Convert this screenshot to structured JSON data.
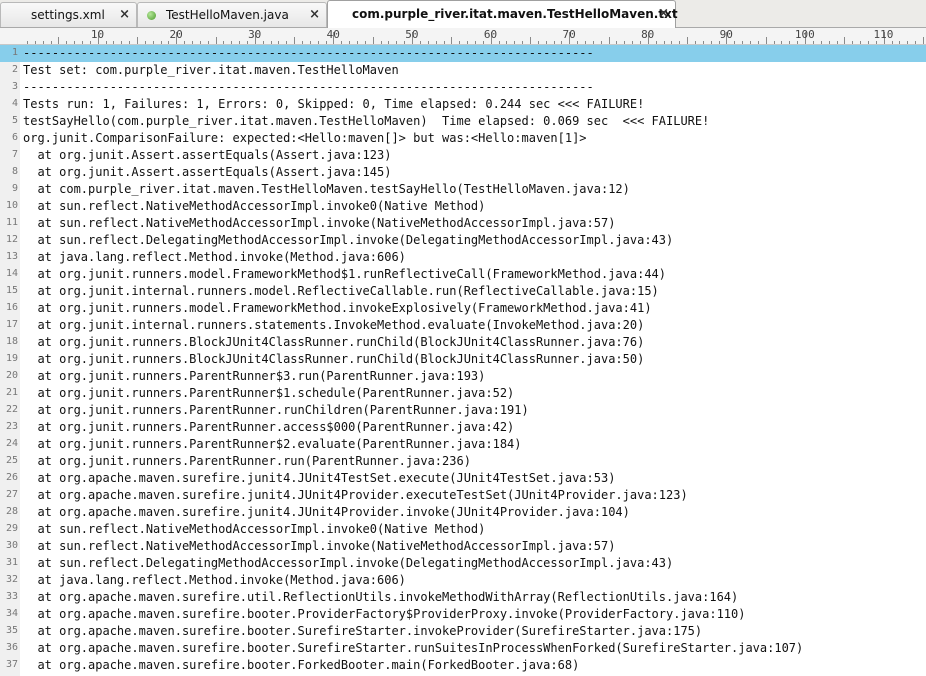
{
  "tabs": [
    {
      "label": "settings.xml",
      "close": "×",
      "icon": "none",
      "active": false
    },
    {
      "label": "TestHelloMaven.java",
      "close": "×",
      "icon": "green-dot-icon",
      "active": false
    },
    {
      "label": "com.purple_river.itat.maven.TestHelloMaven.txt",
      "close": "×",
      "icon": "none",
      "active": true
    }
  ],
  "ruler": {
    "labels": [
      "10",
      "20",
      "30",
      "40",
      "50",
      "60",
      "70",
      "80",
      "90",
      "100",
      "110"
    ]
  },
  "colors": {
    "current_line": "#87ceeb",
    "gutter": "#f0f0f0",
    "tabbar": "#ecebe8"
  },
  "editor": {
    "lines": [
      {
        "n": "1",
        "text": "-------------------------------------------------------------------------------"
      },
      {
        "n": "2",
        "text": "Test set: com.purple_river.itat.maven.TestHelloMaven"
      },
      {
        "n": "3",
        "text": "-------------------------------------------------------------------------------"
      },
      {
        "n": "4",
        "text": "Tests run: 1, Failures: 1, Errors: 0, Skipped: 0, Time elapsed: 0.244 sec <<< FAILURE!"
      },
      {
        "n": "5",
        "text": "testSayHello(com.purple_river.itat.maven.TestHelloMaven)  Time elapsed: 0.069 sec  <<< FAILURE!"
      },
      {
        "n": "6",
        "text": "org.junit.ComparisonFailure: expected:<Hello:maven[]> but was:<Hello:maven[1]>"
      },
      {
        "n": "7",
        "text": "  at org.junit.Assert.assertEquals(Assert.java:123)"
      },
      {
        "n": "8",
        "text": "  at org.junit.Assert.assertEquals(Assert.java:145)"
      },
      {
        "n": "9",
        "text": "  at com.purple_river.itat.maven.TestHelloMaven.testSayHello(TestHelloMaven.java:12)"
      },
      {
        "n": "10",
        "text": "  at sun.reflect.NativeMethodAccessorImpl.invoke0(Native Method)"
      },
      {
        "n": "11",
        "text": "  at sun.reflect.NativeMethodAccessorImpl.invoke(NativeMethodAccessorImpl.java:57)"
      },
      {
        "n": "12",
        "text": "  at sun.reflect.DelegatingMethodAccessorImpl.invoke(DelegatingMethodAccessorImpl.java:43)"
      },
      {
        "n": "13",
        "text": "  at java.lang.reflect.Method.invoke(Method.java:606)"
      },
      {
        "n": "14",
        "text": "  at org.junit.runners.model.FrameworkMethod$1.runReflectiveCall(FrameworkMethod.java:44)"
      },
      {
        "n": "15",
        "text": "  at org.junit.internal.runners.model.ReflectiveCallable.run(ReflectiveCallable.java:15)"
      },
      {
        "n": "16",
        "text": "  at org.junit.runners.model.FrameworkMethod.invokeExplosively(FrameworkMethod.java:41)"
      },
      {
        "n": "17",
        "text": "  at org.junit.internal.runners.statements.InvokeMethod.evaluate(InvokeMethod.java:20)"
      },
      {
        "n": "18",
        "text": "  at org.junit.runners.BlockJUnit4ClassRunner.runChild(BlockJUnit4ClassRunner.java:76)"
      },
      {
        "n": "19",
        "text": "  at org.junit.runners.BlockJUnit4ClassRunner.runChild(BlockJUnit4ClassRunner.java:50)"
      },
      {
        "n": "20",
        "text": "  at org.junit.runners.ParentRunner$3.run(ParentRunner.java:193)"
      },
      {
        "n": "21",
        "text": "  at org.junit.runners.ParentRunner$1.schedule(ParentRunner.java:52)"
      },
      {
        "n": "22",
        "text": "  at org.junit.runners.ParentRunner.runChildren(ParentRunner.java:191)"
      },
      {
        "n": "23",
        "text": "  at org.junit.runners.ParentRunner.access$000(ParentRunner.java:42)"
      },
      {
        "n": "24",
        "text": "  at org.junit.runners.ParentRunner$2.evaluate(ParentRunner.java:184)"
      },
      {
        "n": "25",
        "text": "  at org.junit.runners.ParentRunner.run(ParentRunner.java:236)"
      },
      {
        "n": "26",
        "text": "  at org.apache.maven.surefire.junit4.JUnit4TestSet.execute(JUnit4TestSet.java:53)"
      },
      {
        "n": "27",
        "text": "  at org.apache.maven.surefire.junit4.JUnit4Provider.executeTestSet(JUnit4Provider.java:123)"
      },
      {
        "n": "28",
        "text": "  at org.apache.maven.surefire.junit4.JUnit4Provider.invoke(JUnit4Provider.java:104)"
      },
      {
        "n": "29",
        "text": "  at sun.reflect.NativeMethodAccessorImpl.invoke0(Native Method)"
      },
      {
        "n": "30",
        "text": "  at sun.reflect.NativeMethodAccessorImpl.invoke(NativeMethodAccessorImpl.java:57)"
      },
      {
        "n": "31",
        "text": "  at sun.reflect.DelegatingMethodAccessorImpl.invoke(DelegatingMethodAccessorImpl.java:43)"
      },
      {
        "n": "32",
        "text": "  at java.lang.reflect.Method.invoke(Method.java:606)"
      },
      {
        "n": "33",
        "text": "  at org.apache.maven.surefire.util.ReflectionUtils.invokeMethodWithArray(ReflectionUtils.java:164)"
      },
      {
        "n": "34",
        "text": "  at org.apache.maven.surefire.booter.ProviderFactory$ProviderProxy.invoke(ProviderFactory.java:110)"
      },
      {
        "n": "35",
        "text": "  at org.apache.maven.surefire.booter.SurefireStarter.invokeProvider(SurefireStarter.java:175)"
      },
      {
        "n": "36",
        "text": "  at org.apache.maven.surefire.booter.SurefireStarter.runSuitesInProcessWhenForked(SurefireStarter.java:107)"
      },
      {
        "n": "37",
        "text": "  at org.apache.maven.surefire.booter.ForkedBooter.main(ForkedBooter.java:68)"
      }
    ]
  }
}
